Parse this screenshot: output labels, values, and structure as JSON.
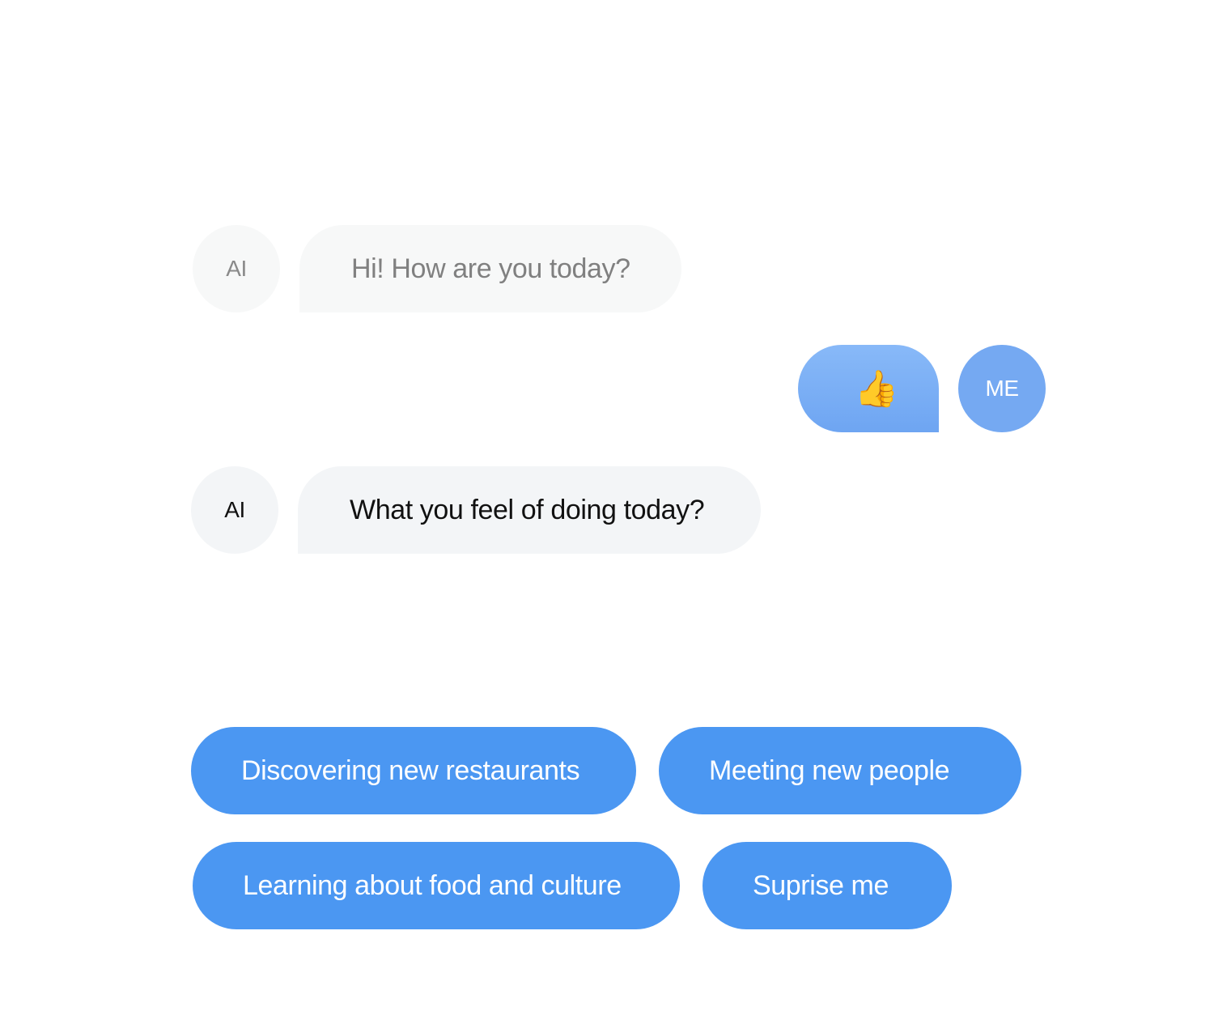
{
  "conversation": {
    "messages": [
      {
        "sender_label": "AI",
        "text": "Hi! How are you today?"
      },
      {
        "sender_label": "ME",
        "text": "👍",
        "icon": "thumbs-up-icon"
      },
      {
        "sender_label": "AI",
        "text": "What you feel of doing today?"
      }
    ]
  },
  "quick_replies": [
    {
      "label": "Discovering new restaurants"
    },
    {
      "label": "Meeting new people"
    },
    {
      "label": "Learning about food and culture"
    },
    {
      "label": "Suprise me"
    }
  ],
  "colors": {
    "chip_bg": "#4b97f2",
    "user_bubble": "#75a9f2",
    "ai_bubble": "#f3f5f7"
  }
}
